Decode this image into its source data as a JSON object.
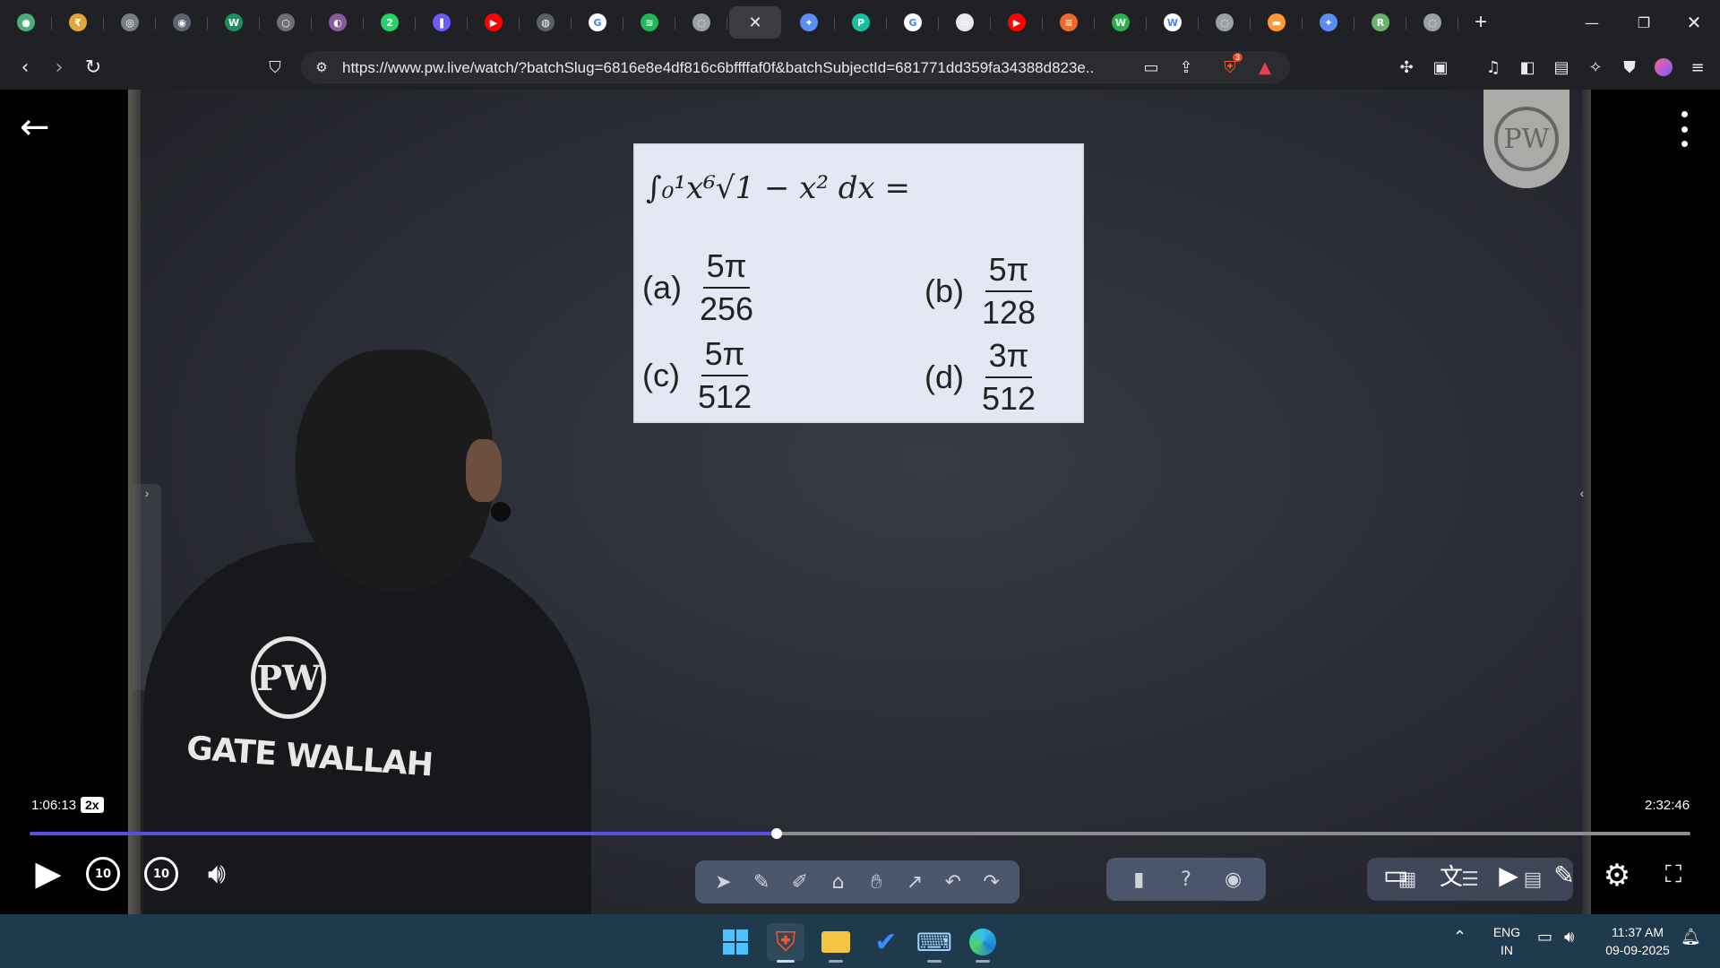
{
  "browser": {
    "tabs": [
      {
        "icon": "chat-favicon",
        "color": "#4caf7a",
        "glyph": "●"
      },
      {
        "icon": "yellow-circle-favicon",
        "color": "#e0a73a",
        "glyph": "₹"
      },
      {
        "icon": "gray-circle-favicon",
        "color": "#7a7d82",
        "glyph": "◎"
      },
      {
        "icon": "dark-circle-favicon",
        "color": "#5d6670",
        "glyph": "◉"
      },
      {
        "icon": "w3-favicon",
        "color": "#1b8f5e",
        "glyph": "W"
      },
      {
        "icon": "gray-favicon",
        "color": "#6d6f73",
        "glyph": "○"
      },
      {
        "icon": "purple-favicon",
        "color": "#8a5a9e",
        "glyph": "◐"
      },
      {
        "icon": "whatsapp-favicon",
        "color": "#25d366",
        "glyph": "2"
      },
      {
        "icon": "bookmark-favicon",
        "color": "#6a5cff",
        "glyph": "❚"
      },
      {
        "icon": "youtube-favicon",
        "color": "#ff0000",
        "glyph": "▶"
      },
      {
        "icon": "gate-favicon",
        "color": "#5b5f66",
        "glyph": "◍"
      },
      {
        "icon": "google-favicon",
        "color": "#ffffff",
        "glyph": "G"
      },
      {
        "icon": "spotify-favicon",
        "color": "#1db954",
        "glyph": "≋"
      },
      {
        "icon": "globe-favicon",
        "color": "#9aa0a6",
        "glyph": "◌"
      },
      {
        "icon": "close-icon",
        "color": "#e8eaed",
        "glyph": "✕",
        "active": true
      },
      {
        "icon": "gemini-favicon",
        "color": "#5b8ef5",
        "glyph": "✦"
      },
      {
        "icon": "copilot-favicon",
        "color": "#13c2a3",
        "glyph": "P"
      },
      {
        "icon": "google-favicon",
        "color": "#ffffff",
        "glyph": "G"
      },
      {
        "icon": "monitor-favicon",
        "color": "#e8eaed",
        "glyph": "▭"
      },
      {
        "icon": "youtube-favicon",
        "color": "#ff0000",
        "glyph": "▶"
      },
      {
        "icon": "orange-circle-favicon",
        "color": "#f06b2a",
        "glyph": "≡"
      },
      {
        "icon": "green-favicon",
        "color": "#2ab24a",
        "glyph": "W"
      },
      {
        "icon": "wikipedia-favicon",
        "color": "#ffffff",
        "glyph": "W"
      },
      {
        "icon": "globe-favicon",
        "color": "#9aa0a6",
        "glyph": "◌"
      },
      {
        "icon": "india-flag-favicon",
        "color": "#ff9933",
        "glyph": "▬"
      },
      {
        "icon": "gemini-favicon",
        "color": "#5b8ef5",
        "glyph": "✦"
      },
      {
        "icon": "green-circle-favicon",
        "color": "#6bb36b",
        "glyph": "R"
      },
      {
        "icon": "globe-favicon",
        "color": "#9aa0a6",
        "glyph": "◌"
      }
    ],
    "new_tab_label": "+",
    "url": "https://www.pw.live/watch/?batchSlug=6816e8e4df816c6bffffaf0f&batchSubjectId=681771dd359fa34388d823e...",
    "brave_badge": "3"
  },
  "player": {
    "question": {
      "stem": "∫₀¹x⁶√1 − x² dx =",
      "options": [
        {
          "label": "(a)",
          "num": "5π",
          "den": "256"
        },
        {
          "label": "(b)",
          "num": "5π",
          "den": "128"
        },
        {
          "label": "(c)",
          "num": "5π",
          "den": "512"
        },
        {
          "label": "(d)",
          "num": "3π",
          "den": "512"
        }
      ]
    },
    "shirt_text": "GATE WALLAH",
    "shirt_logo": "PW",
    "watermark": "PW",
    "current_time": "1:06:13",
    "speed": "2x",
    "total_time": "2:32:46",
    "progress_fraction": 0.4496,
    "skip_back_label": "10",
    "skip_forward_label": "10",
    "accent": "#5a4fe0"
  },
  "taskbar": {
    "lang": "ENG",
    "region": "IN",
    "time": "11:37 AM",
    "date": "09-09-2025"
  }
}
